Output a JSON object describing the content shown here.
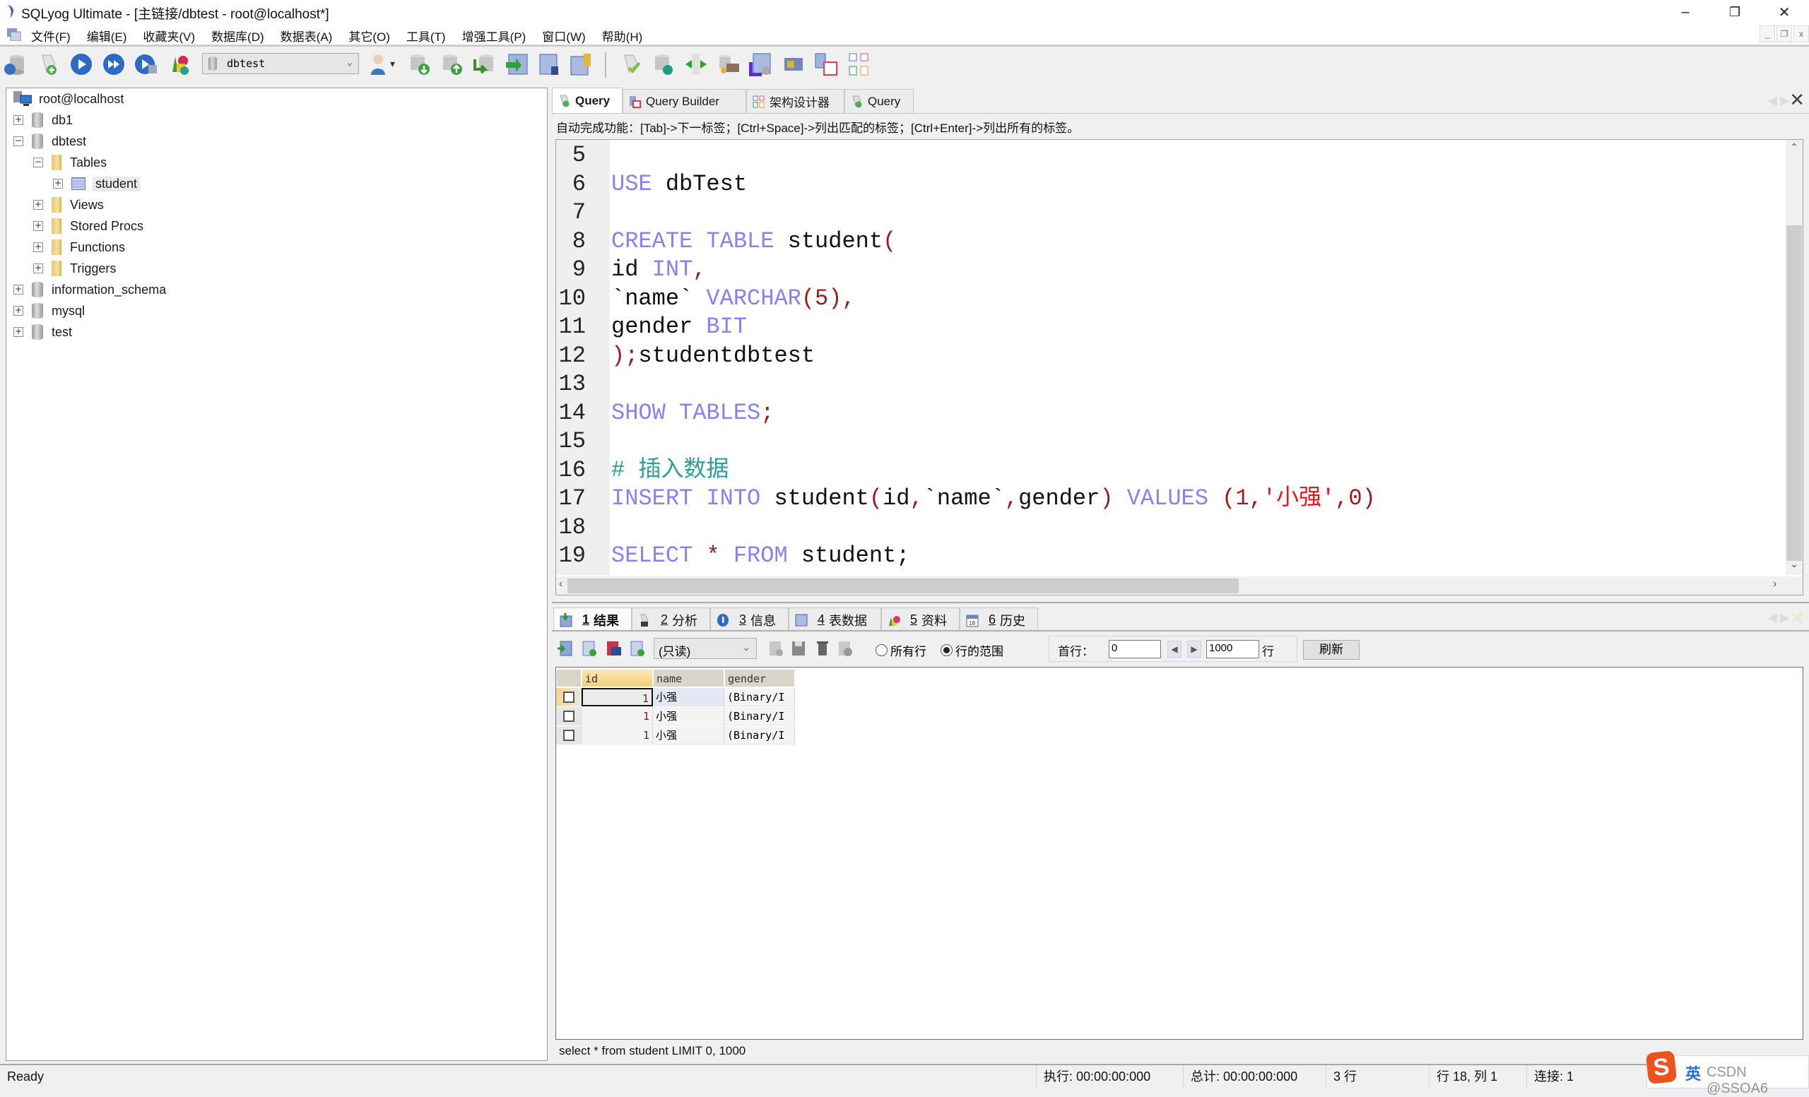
{
  "window": {
    "title": "SQLyog Ultimate - [主链接/dbtest - root@localhost*]",
    "controls": {
      "minimize": "–",
      "restore": "❐",
      "close": "✕"
    },
    "mdi_controls": {
      "minimize": "_",
      "restore": "❐",
      "close": "x"
    }
  },
  "menu": {
    "items": [
      "文件(F)",
      "编辑(E)",
      "收藏夹(V)",
      "数据库(D)",
      "数据表(A)",
      "其它(O)",
      "工具(T)",
      "增强工具(P)",
      "窗口(W)",
      "帮助(H)"
    ]
  },
  "toolbar": {
    "database_select": {
      "value": "dbtest",
      "caret": "⌄"
    },
    "user_dropdown_caret": "▾",
    "icons_left": [
      "connection-icon",
      "new-query-icon",
      "execute-query-icon",
      "execute-all-icon",
      "execute-edit-icon",
      "schema-sync-icon"
    ],
    "icons_right": [
      "user-manager-icon",
      "backup-db-icon",
      "restore-db-icon",
      "import-icon",
      "import-external-icon",
      "table-data-icon",
      "table-key-icon"
    ],
    "icons_extra": [
      "query-check-icon",
      "db-sync-icon",
      "compare-icon",
      "copy-db-icon",
      "scheduled-backup-icon",
      "notification-icon",
      "table-diagram-icon",
      "schema-designer-icon"
    ]
  },
  "object_browser": {
    "root": "root@localhost",
    "nodes": [
      {
        "label": "db1",
        "type": "database",
        "toggle": "+",
        "level": 1
      },
      {
        "label": "dbtest",
        "type": "database",
        "toggle": "−",
        "level": 1
      },
      {
        "label": "Tables",
        "type": "folder",
        "toggle": "−",
        "level": 2
      },
      {
        "label": "student",
        "type": "table",
        "toggle": "+",
        "level": 3,
        "selected": true
      },
      {
        "label": "Views",
        "type": "folder",
        "toggle": "+",
        "level": 2
      },
      {
        "label": "Stored Procs",
        "type": "folder",
        "toggle": "+",
        "level": 2
      },
      {
        "label": "Functions",
        "type": "folder",
        "toggle": "+",
        "level": 2
      },
      {
        "label": "Triggers",
        "type": "folder",
        "toggle": "+",
        "level": 2
      },
      {
        "label": "information_schema",
        "type": "database",
        "toggle": "+",
        "level": 1
      },
      {
        "label": "mysql",
        "type": "database",
        "toggle": "+",
        "level": 1
      },
      {
        "label": "test",
        "type": "database",
        "toggle": "+",
        "level": 1
      }
    ]
  },
  "query_tabs": {
    "tabs": [
      {
        "label": "Query",
        "active": true
      },
      {
        "label": "Query Builder",
        "active": false
      },
      {
        "label": "架构设计器",
        "active": false
      },
      {
        "label": "Query",
        "active": false
      }
    ],
    "nav_prev": "◀",
    "nav_next": "▶",
    "close": "✕"
  },
  "autocomplete_hint": "自动完成功能：[Tab]->下一标签；[Ctrl+Space]->列出匹配的标签；[Ctrl+Enter]->列出所有的标签。",
  "editor": {
    "lines": [
      {
        "n": "5",
        "tokens": []
      },
      {
        "n": "6",
        "tokens": [
          [
            "kw",
            "USE"
          ],
          [
            "",
            " dbTest"
          ]
        ]
      },
      {
        "n": "7",
        "tokens": []
      },
      {
        "n": "8",
        "tokens": [
          [
            "kw",
            "CREATE"
          ],
          [
            "",
            " "
          ],
          [
            "kw",
            "TABLE"
          ],
          [
            "",
            " student"
          ],
          [
            "op",
            "("
          ]
        ]
      },
      {
        "n": "9",
        "tokens": [
          [
            "",
            "id "
          ],
          [
            "kw",
            "INT"
          ],
          [
            "op",
            ","
          ]
        ]
      },
      {
        "n": "10",
        "tokens": [
          [
            "",
            "`name` "
          ],
          [
            "kw",
            "VARCHAR"
          ],
          [
            "op",
            "(5),"
          ]
        ]
      },
      {
        "n": "11",
        "tokens": [
          [
            "",
            "gender "
          ],
          [
            "kw",
            "BIT"
          ]
        ]
      },
      {
        "n": "12",
        "tokens": [
          [
            "op",
            ");"
          ],
          [
            "",
            "studentdbtest"
          ]
        ]
      },
      {
        "n": "13",
        "tokens": []
      },
      {
        "n": "14",
        "tokens": [
          [
            "kw",
            "SHOW"
          ],
          [
            "",
            " "
          ],
          [
            "kw",
            "TABLES"
          ],
          [
            "op",
            ";"
          ]
        ]
      },
      {
        "n": "15",
        "tokens": []
      },
      {
        "n": "16",
        "tokens": [
          [
            "cm",
            "# 插入数据"
          ]
        ]
      },
      {
        "n": "17",
        "tokens": [
          [
            "kw",
            "INSERT"
          ],
          [
            "",
            " "
          ],
          [
            "kw",
            "INTO"
          ],
          [
            "",
            " student"
          ],
          [
            "op",
            "("
          ],
          [
            "",
            "id"
          ],
          [
            "op",
            ","
          ],
          [
            "",
            "`name`"
          ],
          [
            "op",
            ","
          ],
          [
            "",
            "gender"
          ],
          [
            "op",
            ")"
          ],
          [
            "",
            " "
          ],
          [
            "kw",
            "VALUES"
          ],
          [
            "",
            " "
          ],
          [
            "op",
            "(1,"
          ],
          [
            "str",
            "'小强'"
          ],
          [
            "op",
            ",0)"
          ]
        ]
      },
      {
        "n": "18",
        "tokens": []
      },
      {
        "n": "19",
        "tokens": [
          [
            "kw",
            "SELECT"
          ],
          [
            "",
            " "
          ],
          [
            "op",
            "*"
          ],
          [
            "",
            " "
          ],
          [
            "kw",
            "FROM"
          ],
          [
            "",
            " student;"
          ]
        ]
      }
    ],
    "vscroll": {
      "up": "⌃",
      "down": "⌄"
    },
    "hscroll": {
      "left": "‹",
      "right": "›"
    }
  },
  "result_tabs": {
    "tabs": [
      {
        "key": "1",
        "label": "结果",
        "active": true
      },
      {
        "key": "2",
        "label": "分析",
        "active": false
      },
      {
        "key": "3",
        "label": "信息",
        "active": false
      },
      {
        "key": "4",
        "label": "表数据",
        "active": false
      },
      {
        "key": "5",
        "label": "资料",
        "active": false
      },
      {
        "key": "6",
        "label": "历史",
        "active": false
      }
    ]
  },
  "result_toolbar": {
    "mode_select": "(只读)",
    "radio_all_rows": "所有行",
    "radio_row_range": "行的范围",
    "selected_radio": "行的范围",
    "first_row_label": "首行：",
    "first_row_value": "0",
    "row_count_value": "1000",
    "rows_unit": "行",
    "refresh_label": "刷新"
  },
  "result_grid": {
    "columns": [
      "id",
      "name",
      "gender"
    ],
    "rows": [
      [
        "1",
        "小强",
        "(Binary/I"
      ],
      [
        "1",
        "小强",
        "(Binary/I"
      ],
      [
        "1",
        "小强",
        "(Binary/I"
      ]
    ]
  },
  "executed_sql": "select * from student LIMIT 0, 1000",
  "statusbar": {
    "status": "Ready",
    "exec_time": "执行: 00:00:00:000",
    "total_time": "总计: 00:00:00:000",
    "rows": "3 行",
    "cursor": "行 18, 列 1",
    "connections": "连接: 1"
  },
  "ime": {
    "logo": "S",
    "mode": "英",
    "watermark": "CSDN @SSOA6"
  }
}
